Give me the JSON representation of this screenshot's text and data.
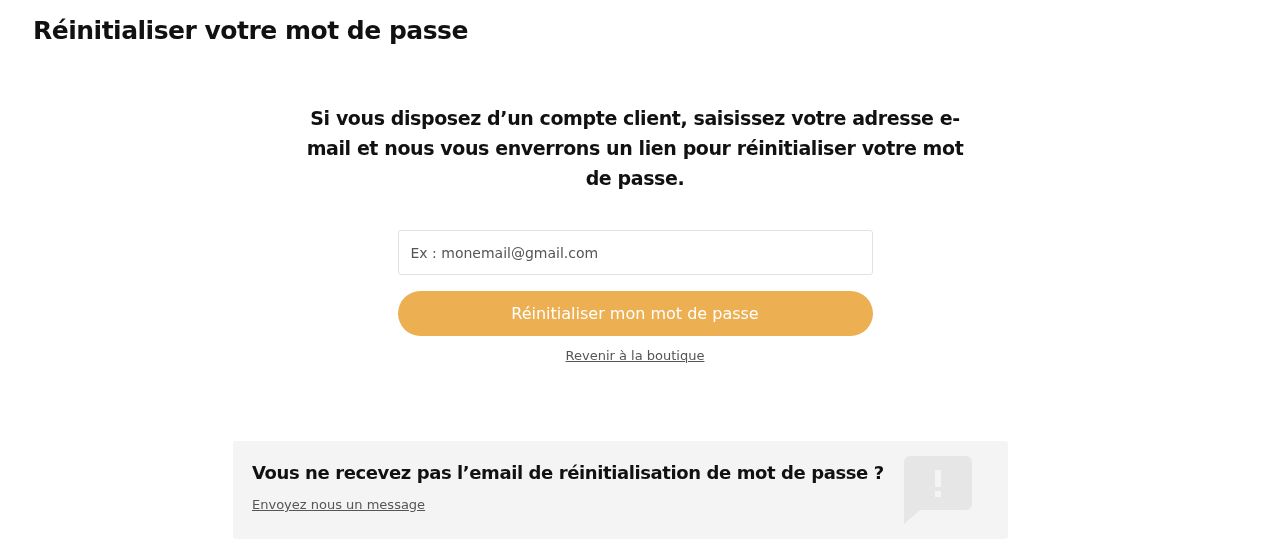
{
  "page_title": "Réinitialiser votre mot de passe",
  "intro": "Si vous disposez d’un compte client, saisissez votre adresse e-mail et nous vous enverrons un lien pour réinitialiser votre mot de passe.",
  "email_field": {
    "placeholder": "Ex : monemail@gmail.com"
  },
  "submit_button": "Réinitialiser mon mot de passe",
  "back_link": "Revenir à la boutique",
  "help_box": {
    "title": "Vous ne recevez pas l’email de réinitialisation de mot de passe ?",
    "link": "Envoyez nous un message"
  }
}
